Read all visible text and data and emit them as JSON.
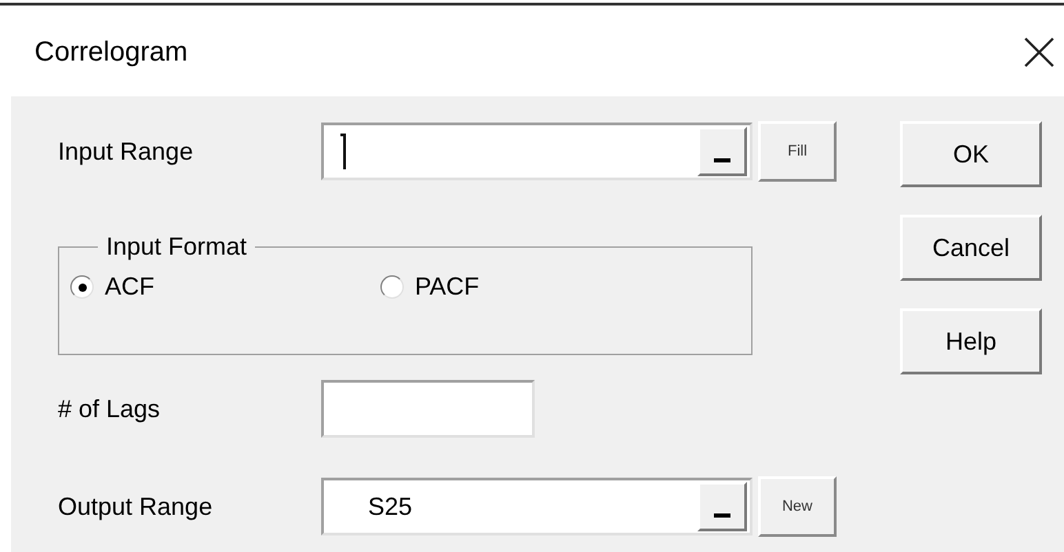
{
  "window": {
    "title": "Correlogram"
  },
  "input_range": {
    "label": "Input Range",
    "focused": true,
    "button": "Fill"
  },
  "input_format": {
    "title": "Input Format",
    "options": [
      {
        "label": "ACF",
        "selected": true
      },
      {
        "label": "PACF",
        "selected": false
      }
    ]
  },
  "lags": {
    "label": "# of Lags"
  },
  "output_range": {
    "label": "Output Range",
    "value": "S25",
    "button": "New"
  },
  "buttons": [
    "OK",
    "Cancel",
    "Help"
  ]
}
